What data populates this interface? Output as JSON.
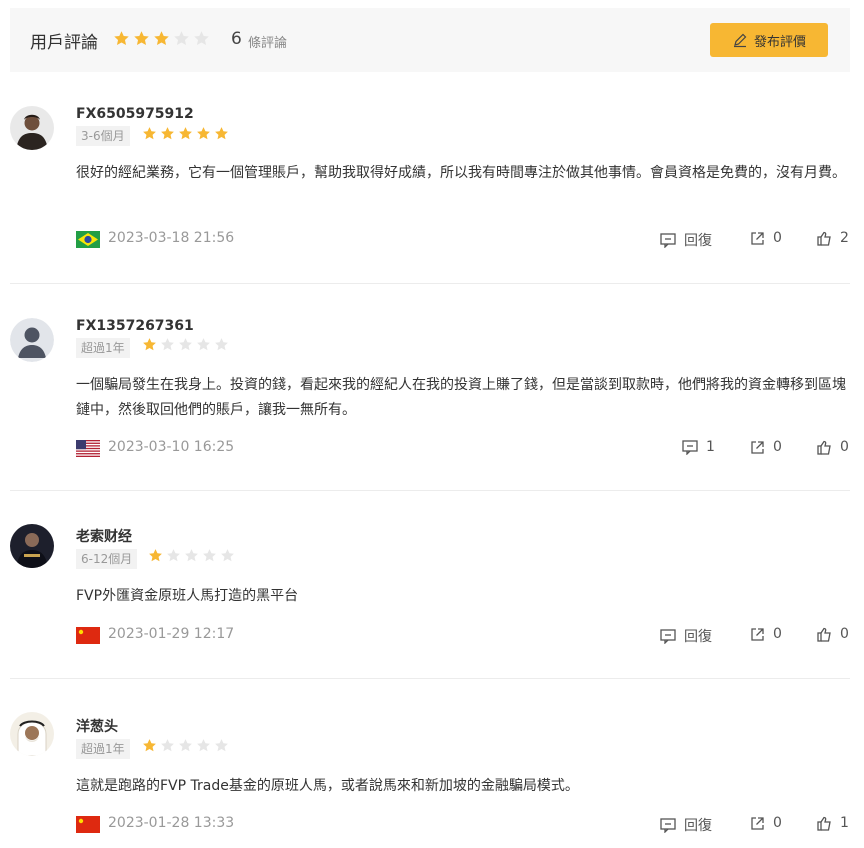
{
  "header": {
    "title": "用戶評論",
    "rating": 3,
    "count": "6",
    "count_label": "條評論",
    "post_button": "發布評價"
  },
  "colors": {
    "star_filled": "#f7b733",
    "star_empty": "#e6e6e6",
    "accent": "#f7b733"
  },
  "labels": {
    "reply": "回復"
  },
  "reviews": [
    {
      "username": "FX6505975912",
      "badge": "3-6個月",
      "rating": 5,
      "content": "很好的經紀業務，它有一個管理賬戶，幫助我取得好成績，所以我有時間專注於做其他事情。會員資格是免費的，沒有月費。",
      "country_flag": "brazil-flag",
      "date": "2023-03-18 21:56",
      "reply_count": "",
      "shares": "0",
      "likes": "2"
    },
    {
      "username": "FX1357267361",
      "badge": "超過1年",
      "rating": 1,
      "content": "一個騙局發生在我身上。投資的錢，看起來我的經紀人在我的投資上賺了錢，但是當談到取款時，他們將我的資金轉移到區塊鏈中，然後取回他們的賬戶，讓我一無所有。",
      "country_flag": "usa-flag",
      "date": "2023-03-10 16:25",
      "reply_count": "1",
      "shares": "0",
      "likes": "0"
    },
    {
      "username": "老索财经",
      "badge": "6-12個月",
      "rating": 1,
      "content": "FVP外匯資金原班人馬打造的黑平台",
      "country_flag": "china-flag",
      "date": "2023-01-29 12:17",
      "reply_count": "",
      "shares": "0",
      "likes": "0"
    },
    {
      "username": "洋葱头",
      "badge": "超過1年",
      "rating": 1,
      "content": "這就是跑路的FVP Trade基金的原班人馬，或者說馬來和新加坡的金融騙局模式。",
      "country_flag": "china-flag",
      "date": "2023-01-28 13:33",
      "reply_count": "",
      "shares": "0",
      "likes": "1"
    }
  ]
}
